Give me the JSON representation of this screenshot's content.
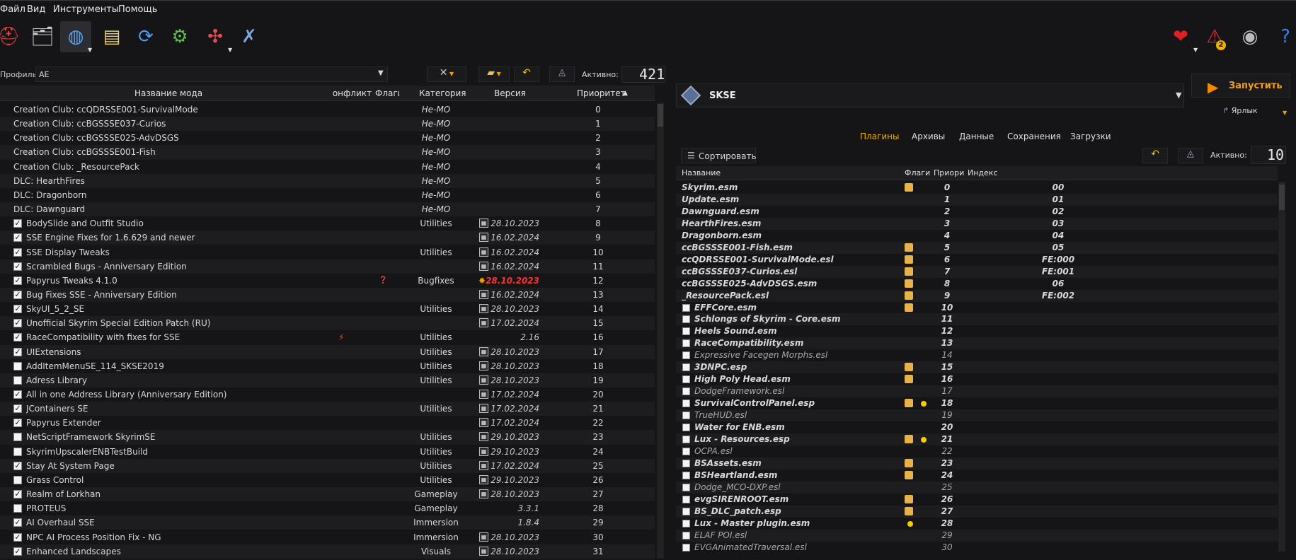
{
  "menu": [
    "Файл",
    "Вид",
    "Инструменты",
    "Помощь"
  ],
  "toolbar": {
    "left_icons": [
      "profiles-icon",
      "archive-icon",
      "globe-icon",
      "nexus-id-icon",
      "refresh-icon",
      "settings-icon",
      "puzzle-icon",
      "tools-icon"
    ],
    "right_icons": [
      "heart-icon",
      "warning-icon",
      "update-icon",
      "help-icon"
    ],
    "warning_count": "2"
  },
  "profile": {
    "label": "Профиль",
    "value": "AE",
    "active_label": "Активно:",
    "active_count": "421"
  },
  "mods_table": {
    "headers": [
      "Название мода",
      "Конфликт",
      "Флаги",
      "Категория",
      "Версия",
      "Приоритет"
    ],
    "rows": [
      {
        "name": "Creation Club: ccQDRSSE001-SurvivalMode",
        "cat": "Не-MO",
        "ver": "",
        "prio": "0",
        "cb": "none",
        "cal": false
      },
      {
        "name": "Creation Club: ccBGSSSE037-Curios",
        "cat": "Не-MO",
        "ver": "",
        "prio": "1",
        "cb": "none",
        "cal": false
      },
      {
        "name": "Creation Club: ccBGSSSE025-AdvDSGS",
        "cat": "Не-MO",
        "ver": "",
        "prio": "2",
        "cb": "none",
        "cal": false
      },
      {
        "name": "Creation Club: ccBGSSSE001-Fish",
        "cat": "Не-MO",
        "ver": "",
        "prio": "3",
        "cb": "none",
        "cal": false
      },
      {
        "name": "Creation Club: _ResourcePack",
        "cat": "Не-MO",
        "ver": "",
        "prio": "4",
        "cb": "none",
        "cal": false
      },
      {
        "name": "DLC: HearthFires",
        "cat": "Не-MO",
        "ver": "",
        "prio": "5",
        "cb": "none",
        "cal": false
      },
      {
        "name": "DLC: Dragonborn",
        "cat": "Не-MO",
        "ver": "",
        "prio": "6",
        "cb": "none",
        "cal": false
      },
      {
        "name": "DLC: Dawnguard",
        "cat": "Не-MO",
        "ver": "",
        "prio": "7",
        "cb": "none",
        "cal": false
      },
      {
        "name": "BodySlide and Outfit Studio",
        "cat": "Utilities",
        "ver": "28.10.2023",
        "prio": "8",
        "cb": "on",
        "cal": true
      },
      {
        "name": "SSE Engine Fixes for 1.6.629 and newer",
        "cat": "",
        "ver": "16.02.2024",
        "prio": "9",
        "cb": "on",
        "cal": true
      },
      {
        "name": "SSE Display Tweaks",
        "cat": "Utilities",
        "ver": "16.02.2024",
        "prio": "10",
        "cb": "on",
        "cal": true
      },
      {
        "name": "Scrambled Bugs - Anniversary Edition",
        "cat": "",
        "ver": "16.02.2024",
        "prio": "11",
        "cb": "on",
        "cal": true
      },
      {
        "name": "Papyrus Tweaks 4.1.0",
        "cat": "Bugfixes",
        "ver": "28.10.2023",
        "prio": "12",
        "cb": "on",
        "cal": false,
        "warn": true,
        "flag": "❓"
      },
      {
        "name": "Bug Fixes SSE - Anniversary Edition",
        "cat": "",
        "ver": "16.02.2024",
        "prio": "13",
        "cb": "on",
        "cal": true
      },
      {
        "name": "SkyUI_5_2_SE",
        "cat": "Utilities",
        "ver": "28.10.2023",
        "prio": "14",
        "cb": "on",
        "cal": true
      },
      {
        "name": "Unofficial Skyrim Special Edition Patch (RU)",
        "cat": "",
        "ver": "17.02.2024",
        "prio": "15",
        "cb": "on",
        "cal": true
      },
      {
        "name": "RaceCompatibility with fixes for SSE",
        "cat": "Utilities",
        "ver": "2.16",
        "prio": "16",
        "cb": "on",
        "cal": false,
        "conflict": "⚡"
      },
      {
        "name": "UIExtensions",
        "cat": "Utilities",
        "ver": "28.10.2023",
        "prio": "17",
        "cb": "on",
        "cal": true
      },
      {
        "name": "AddItemMenuSE_114_SKSE2019",
        "cat": "Utilities",
        "ver": "28.10.2023",
        "prio": "18",
        "cb": "off",
        "cal": true
      },
      {
        "name": "Adress Library",
        "cat": "Utilities",
        "ver": "28.10.2023",
        "prio": "19",
        "cb": "off",
        "cal": true
      },
      {
        "name": "All in one Address Library (Anniversary Edition)",
        "cat": "",
        "ver": "17.02.2024",
        "prio": "20",
        "cb": "on",
        "cal": true
      },
      {
        "name": "JContainers SE",
        "cat": "Utilities",
        "ver": "17.02.2024",
        "prio": "21",
        "cb": "on",
        "cal": true
      },
      {
        "name": "Papyrus Extender",
        "cat": "",
        "ver": "17.02.2024",
        "prio": "22",
        "cb": "on",
        "cal": true
      },
      {
        "name": "NetScriptFramework SkyrimSE",
        "cat": "Utilities",
        "ver": "29.10.2023",
        "prio": "23",
        "cb": "off",
        "cal": true
      },
      {
        "name": "SkyrimUpscalerENBTestBuild",
        "cat": "Utilities",
        "ver": "29.10.2023",
        "prio": "24",
        "cb": "off",
        "cal": true
      },
      {
        "name": "Stay At System Page",
        "cat": "Utilities",
        "ver": "17.02.2024",
        "prio": "25",
        "cb": "on",
        "cal": true
      },
      {
        "name": "Grass Control",
        "cat": "Utilities",
        "ver": "29.10.2023",
        "prio": "26",
        "cb": "off",
        "cal": true
      },
      {
        "name": "Realm of Lorkhan",
        "cat": "Gameplay",
        "ver": "28.10.2023",
        "prio": "27",
        "cb": "on",
        "cal": true
      },
      {
        "name": "PROTEUS",
        "cat": "Gameplay",
        "ver": "3.3.1",
        "prio": "28",
        "cb": "off",
        "cal": false
      },
      {
        "name": "AI Overhaul SSE",
        "cat": "Immersion",
        "ver": "1.8.4",
        "prio": "29",
        "cb": "on",
        "cal": false
      },
      {
        "name": "NPC AI Process Position Fix - NG",
        "cat": "Immersion",
        "ver": "28.10.2023",
        "prio": "30",
        "cb": "on",
        "cal": true
      },
      {
        "name": "Enhanced Landscapes",
        "cat": "Visuals",
        "ver": "28.10.2023",
        "prio": "31",
        "cb": "on",
        "cal": true
      }
    ]
  },
  "executable": {
    "name": "SKSE",
    "run_label": "Запустить",
    "shortcut_label": "Ярлык"
  },
  "tabs": [
    "Плагины",
    "Архивы",
    "Данные",
    "Сохранения",
    "Загрузки"
  ],
  "plugins_toolbar": {
    "sort_label": "Сортировать",
    "active_label": "Активно:",
    "active_count": "10"
  },
  "plugins_table": {
    "headers": [
      "Название",
      "Флаги",
      "Приори",
      "Индекс"
    ],
    "rows": [
      {
        "name": "Skyrim.esm",
        "prio": "0",
        "idx": "00",
        "cb": "none",
        "bold": true,
        "pkg": true
      },
      {
        "name": "Update.esm",
        "prio": "1",
        "idx": "01",
        "cb": "none",
        "bold": true
      },
      {
        "name": "Dawnguard.esm",
        "prio": "2",
        "idx": "02",
        "cb": "none",
        "bold": true
      },
      {
        "name": "HearthFires.esm",
        "prio": "3",
        "idx": "03",
        "cb": "none",
        "bold": true
      },
      {
        "name": "Dragonborn.esm",
        "prio": "4",
        "idx": "04",
        "cb": "none",
        "bold": true
      },
      {
        "name": "ccBGSSSE001-Fish.esm",
        "prio": "5",
        "idx": "05",
        "cb": "none",
        "bold": true,
        "pkg": true
      },
      {
        "name": "ccQDRSSE001-SurvivalMode.esl",
        "prio": "6",
        "idx": "FE:000",
        "cb": "none",
        "bold": true,
        "pkg": true
      },
      {
        "name": "ccBGSSSE037-Curios.esl",
        "prio": "7",
        "idx": "FE:001",
        "cb": "none",
        "bold": true,
        "pkg": true
      },
      {
        "name": "ccBGSSSE025-AdvDSGS.esm",
        "prio": "8",
        "idx": "06",
        "cb": "none",
        "bold": true,
        "pkg": true
      },
      {
        "name": "_ResourcePack.esl",
        "prio": "9",
        "idx": "FE:002",
        "cb": "none",
        "bold": true,
        "pkg": true
      },
      {
        "name": "EFFCore.esm",
        "prio": "10",
        "idx": "",
        "cb": "off",
        "bold": true,
        "pkg": true
      },
      {
        "name": "Schlongs of Skyrim - Core.esm",
        "prio": "11",
        "idx": "",
        "cb": "off",
        "bold": true
      },
      {
        "name": "Heels Sound.esm",
        "prio": "12",
        "idx": "",
        "cb": "off",
        "bold": true
      },
      {
        "name": "RaceCompatibility.esm",
        "prio": "13",
        "idx": "",
        "cb": "off",
        "bold": true
      },
      {
        "name": "Expressive Facegen Morphs.esl",
        "prio": "14",
        "idx": "",
        "cb": "off",
        "bold": false
      },
      {
        "name": "3DNPC.esp",
        "prio": "15",
        "idx": "",
        "cb": "off",
        "bold": true,
        "pkg": true
      },
      {
        "name": "High Poly Head.esm",
        "prio": "16",
        "idx": "",
        "cb": "off",
        "bold": true,
        "pkg": true
      },
      {
        "name": "DodgeFramework.esl",
        "prio": "17",
        "idx": "",
        "cb": "off",
        "bold": false
      },
      {
        "name": "SurvivalControlPanel.esp",
        "prio": "18",
        "idx": "",
        "cb": "off",
        "bold": true,
        "pkg": true,
        "dot": true
      },
      {
        "name": "TrueHUD.esl",
        "prio": "19",
        "idx": "",
        "cb": "off",
        "bold": false
      },
      {
        "name": "Water for ENB.esm",
        "prio": "20",
        "idx": "",
        "cb": "off",
        "bold": true
      },
      {
        "name": "Lux - Resources.esp",
        "prio": "21",
        "idx": "",
        "cb": "off",
        "bold": true,
        "pkg": true,
        "dot": true
      },
      {
        "name": "OCPA.esl",
        "prio": "22",
        "idx": "",
        "cb": "off",
        "bold": false
      },
      {
        "name": "BSAssets.esm",
        "prio": "23",
        "idx": "",
        "cb": "off",
        "bold": true,
        "pkg": true
      },
      {
        "name": "BSHeartland.esm",
        "prio": "24",
        "idx": "",
        "cb": "off",
        "bold": true,
        "pkg": true
      },
      {
        "name": "Dodge_MCO-DXP.esl",
        "prio": "25",
        "idx": "",
        "cb": "off",
        "bold": false
      },
      {
        "name": "evgSIRENROOT.esm",
        "prio": "26",
        "idx": "",
        "cb": "off",
        "bold": true,
        "pkg": true
      },
      {
        "name": "BS_DLC_patch.esp",
        "prio": "27",
        "idx": "",
        "cb": "off",
        "bold": true,
        "pkg": true
      },
      {
        "name": "Lux - Master plugin.esm",
        "prio": "28",
        "idx": "",
        "cb": "off",
        "bold": true,
        "dot": true
      },
      {
        "name": "ELAF POI.esl",
        "prio": "29",
        "idx": "",
        "cb": "off",
        "bold": false
      },
      {
        "name": "EVGAnimatedTraversal.esl",
        "prio": "30",
        "idx": "",
        "cb": "off",
        "bold": false
      }
    ]
  }
}
